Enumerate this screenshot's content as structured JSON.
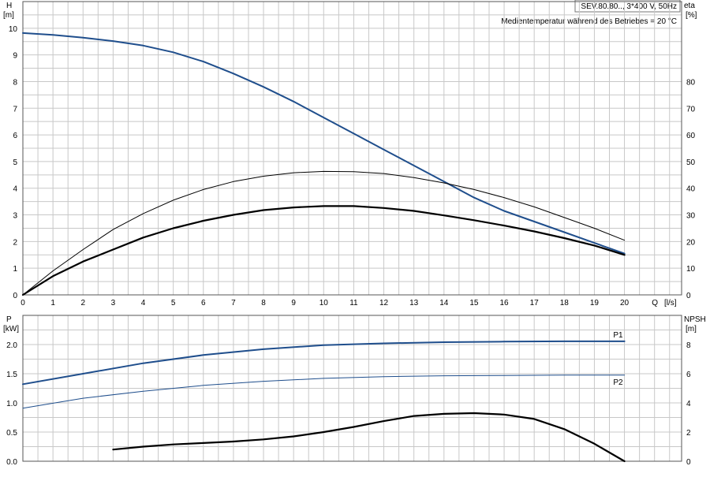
{
  "header": {
    "pump_label": "SEV.80.80.., 3*400 V, 50Hz",
    "condition_text": "Medientemperatur während des Betriebes = 20 °C"
  },
  "chart_data": [
    {
      "type": "line",
      "x_axis": {
        "label": "Q [l/s]",
        "range": [
          0,
          20
        ],
        "ticks": [
          0,
          1,
          2,
          3,
          4,
          5,
          6,
          7,
          8,
          9,
          10,
          11,
          12,
          13,
          14,
          15,
          16,
          17,
          18,
          19,
          20
        ]
      },
      "y_left": {
        "label": "H",
        "unit": "[m]",
        "range": [
          0,
          11
        ],
        "ticks": [
          0,
          1,
          2,
          3,
          4,
          5,
          6,
          7,
          8,
          9,
          10
        ]
      },
      "y_right": {
        "label": "eta",
        "unit": "[%]",
        "range": [
          0,
          110
        ],
        "ticks": [
          0,
          10,
          20,
          30,
          40,
          50,
          60,
          70,
          80
        ]
      },
      "grid": true,
      "series": [
        {
          "name": "",
          "axis": "left",
          "color": "#1f4e8c",
          "stroke": 2,
          "x": [
            0,
            1,
            2,
            3,
            4,
            5,
            6,
            7,
            8,
            9,
            10,
            11,
            12,
            13,
            14,
            15,
            16,
            17,
            18,
            19,
            20
          ],
          "y": [
            9.82,
            9.75,
            9.65,
            9.52,
            9.35,
            9.1,
            8.75,
            8.3,
            7.8,
            7.25,
            6.65,
            6.05,
            5.45,
            4.85,
            4.25,
            3.65,
            3.15,
            2.75,
            2.35,
            1.95,
            1.55
          ]
        },
        {
          "name": "",
          "axis": "right",
          "color": "#000000",
          "stroke": 1,
          "x": [
            0,
            1,
            2,
            3,
            4,
            5,
            6,
            7,
            8,
            9,
            10,
            11,
            12,
            13,
            14,
            15,
            16,
            17,
            18,
            19,
            20
          ],
          "y": [
            0,
            9,
            17,
            24.5,
            30.5,
            35.5,
            39.5,
            42.5,
            44.5,
            45.8,
            46.3,
            46.2,
            45.5,
            44,
            42,
            39.5,
            36.5,
            33,
            29,
            25,
            20.5
          ]
        },
        {
          "name": "",
          "axis": "right",
          "color": "#000000",
          "stroke": 2.2,
          "x": [
            0,
            1,
            2,
            3,
            4,
            5,
            6,
            7,
            8,
            9,
            10,
            11,
            12,
            13,
            14,
            15,
            16,
            17,
            18,
            19,
            20
          ],
          "y": [
            0,
            7,
            12.5,
            17,
            21.5,
            25,
            27.8,
            30,
            31.8,
            32.8,
            33.3,
            33.3,
            32.6,
            31.5,
            29.8,
            28,
            26,
            23.8,
            21.3,
            18.5,
            15
          ]
        }
      ]
    },
    {
      "type": "line",
      "x_axis": {
        "range": [
          0,
          20
        ]
      },
      "y_left": {
        "label": "P",
        "unit": "[kW]",
        "range": [
          0,
          2.5
        ],
        "ticks": [
          0.0,
          0.5,
          1.0,
          1.5,
          2.0
        ],
        "tick_labels": [
          "0.0",
          "0.5",
          "1.0",
          "1.5",
          "2.0"
        ]
      },
      "y_right": {
        "label": "NPSH",
        "unit": "[m]",
        "range": [
          0,
          10
        ],
        "ticks": [
          0,
          2,
          4,
          6,
          8
        ]
      },
      "grid": true,
      "series": [
        {
          "name": "P1",
          "axis": "left",
          "color": "#1f4e8c",
          "stroke": 2,
          "x": [
            0,
            2,
            4,
            6,
            8,
            10,
            12,
            14,
            16,
            18,
            20
          ],
          "y": [
            1.32,
            1.5,
            1.68,
            1.82,
            1.92,
            1.99,
            2.02,
            2.04,
            2.05,
            2.055,
            2.055
          ]
        },
        {
          "name": "P2",
          "axis": "left",
          "color": "#1f4e8c",
          "stroke": 1,
          "x": [
            0,
            2,
            4,
            6,
            8,
            10,
            12,
            14,
            16,
            18,
            20
          ],
          "y": [
            0.91,
            1.08,
            1.2,
            1.3,
            1.37,
            1.42,
            1.45,
            1.465,
            1.47,
            1.475,
            1.475
          ]
        },
        {
          "name": "",
          "axis": "right",
          "color": "#000000",
          "stroke": 2.2,
          "x": [
            3,
            4,
            5,
            6,
            7,
            8,
            9,
            10,
            11,
            12,
            13,
            14,
            15,
            16,
            17,
            18,
            19,
            20
          ],
          "y": [
            0.8,
            1.0,
            1.15,
            1.25,
            1.35,
            1.5,
            1.7,
            2.0,
            2.35,
            2.75,
            3.1,
            3.25,
            3.3,
            3.2,
            2.9,
            2.2,
            1.2,
            0
          ]
        }
      ]
    }
  ]
}
